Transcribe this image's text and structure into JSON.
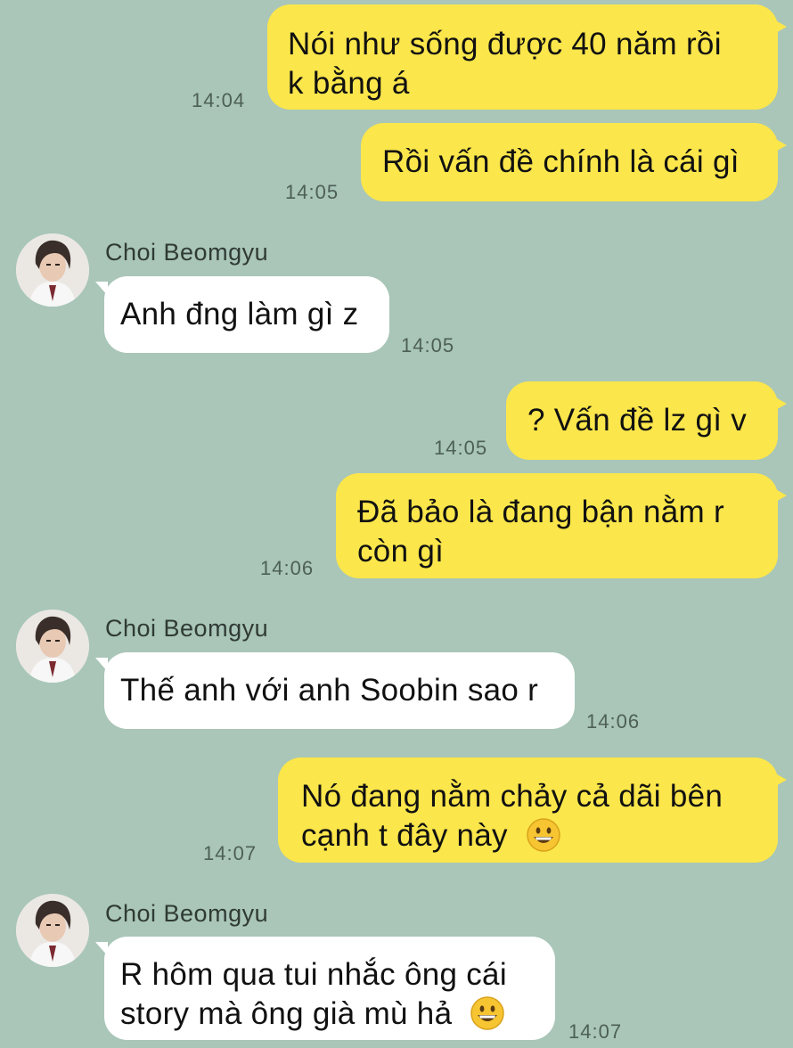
{
  "chat": {
    "contact_name": "Choi Beomgyu",
    "colors": {
      "background": "#a9c6b8",
      "outgoing_bubble": "#fbe64b",
      "incoming_bubble": "#ffffff"
    },
    "messages": [
      {
        "from": "me",
        "lines": [
          "Nói như sống được 40 năm rồi",
          "k bằng á"
        ],
        "time": "14:04"
      },
      {
        "from": "me",
        "lines": [
          "Rồi vấn đề chính là cái gì"
        ],
        "time": "14:05"
      },
      {
        "from": "them",
        "sender": "Choi Beomgyu",
        "lines": [
          "Anh đng làm gì z"
        ],
        "time": "14:05"
      },
      {
        "from": "me",
        "lines": [
          "? Vấn đề lz gì v"
        ],
        "time": "14:05"
      },
      {
        "from": "me",
        "lines": [
          "Đã bảo là đang bận nằm r",
          "còn gì"
        ],
        "time": "14:06"
      },
      {
        "from": "them",
        "sender": "Choi Beomgyu",
        "lines": [
          "Thế anh với anh Soobin sao r"
        ],
        "time": "14:06"
      },
      {
        "from": "me",
        "lines": [
          "Nó đang nằm chảy cả dãi bên",
          "cạnh t đây này"
        ],
        "emoji": "grinning-face-emoji",
        "time": "14:07"
      },
      {
        "from": "them",
        "sender": "Choi Beomgyu",
        "lines": [
          "R hôm qua tui nhắc ông cái",
          "story mà ông già mù hả"
        ],
        "emoji": "grinning-face-emoji",
        "time": "14:07"
      }
    ]
  }
}
